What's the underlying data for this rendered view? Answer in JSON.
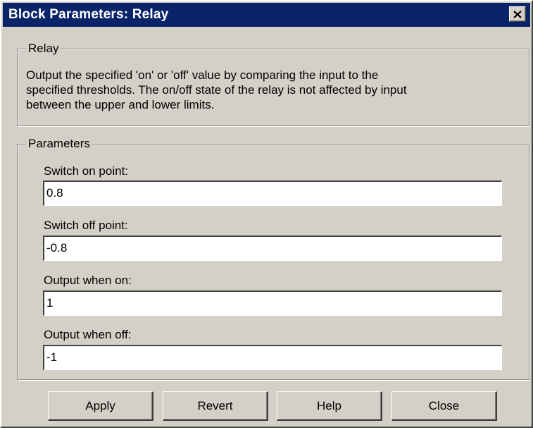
{
  "window": {
    "title": "Block Parameters: Relay"
  },
  "icons": {
    "close": "close-icon"
  },
  "description_group": {
    "legend": "Relay",
    "lines": [
      "Output the specified 'on' or 'off' value by comparing the input to the",
      "specified thresholds.  The on/off state of the relay is not affected by input",
      "between the upper and lower limits."
    ]
  },
  "parameters": {
    "legend": "Parameters",
    "fields": [
      {
        "label": "Switch on point:",
        "value": "0.8"
      },
      {
        "label": "Switch off point:",
        "value": "-0.8"
      },
      {
        "label": "Output when on:",
        "value": "1"
      },
      {
        "label": "Output when off:",
        "value": "-1"
      }
    ]
  },
  "buttons": {
    "apply": "Apply",
    "revert": "Revert",
    "help": "Help",
    "close": "Close"
  },
  "colors": {
    "titlebar": "#0a246a",
    "face": "#d4d0c8"
  }
}
